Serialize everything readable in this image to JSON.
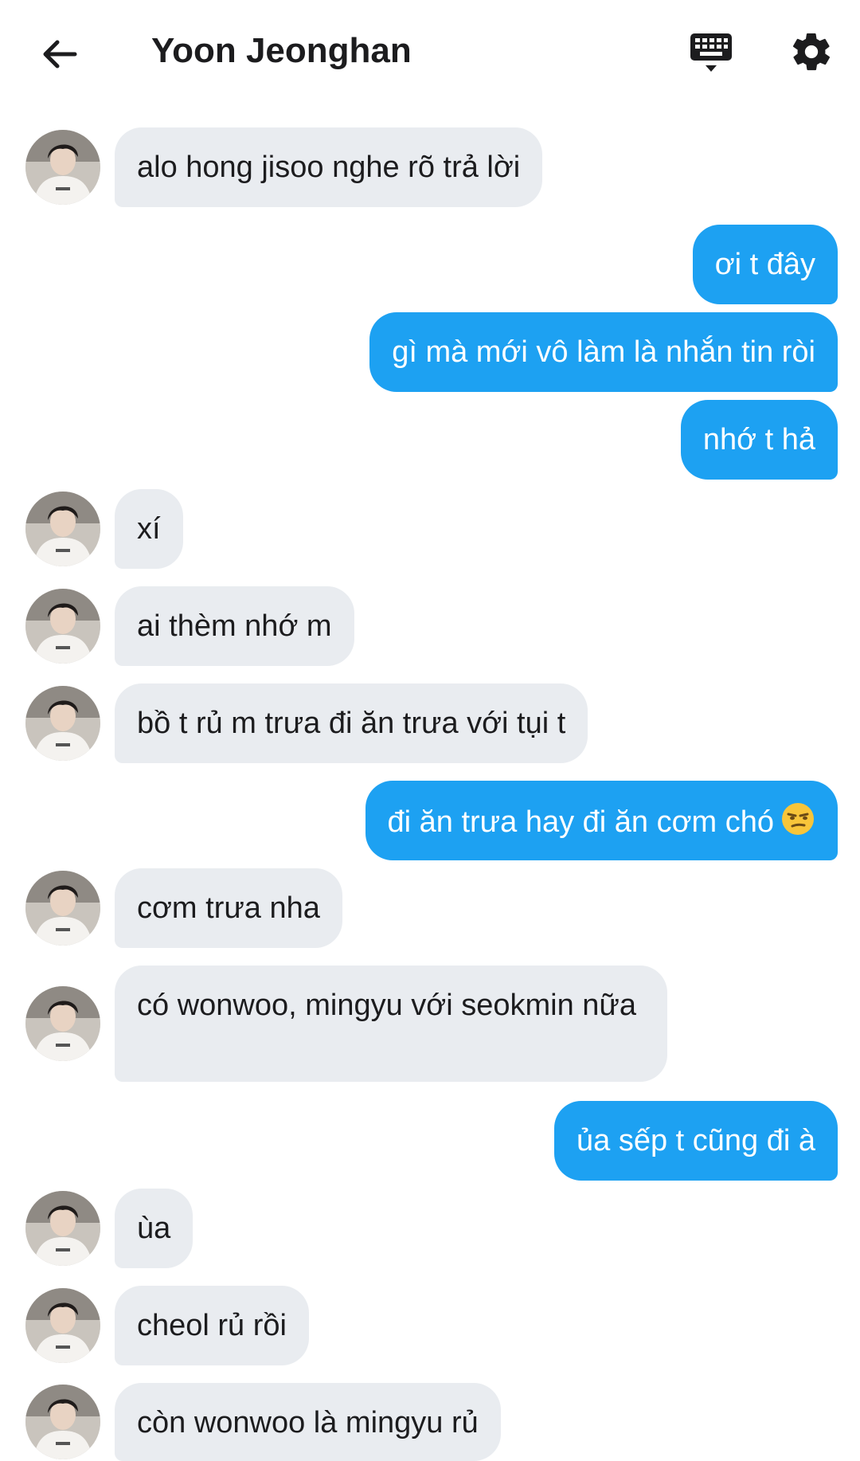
{
  "header": {
    "title": "Yoon Jeonghan"
  },
  "icons": {
    "back": "arrow-left-icon",
    "keyboard": "keyboard-icon",
    "settings": "gear-icon"
  },
  "colors": {
    "outgoing": "#1da1f2",
    "incoming": "#e9ecf0"
  },
  "messages": [
    {
      "side": "in",
      "text": "alo hong jisoo nghe rõ trả lời"
    },
    {
      "side": "out",
      "text": "ơi t đây"
    },
    {
      "side": "out",
      "text": "gì mà mới vô làm là nhắn tin ròi"
    },
    {
      "side": "out",
      "text": "nhớ t hả"
    },
    {
      "side": "in",
      "text": "xí"
    },
    {
      "side": "in",
      "text": "ai thèm nhớ m"
    },
    {
      "side": "in",
      "text": "bồ t rủ m trưa đi ăn trưa với tụi t"
    },
    {
      "side": "out",
      "text": "đi ăn trưa hay đi ăn cơm chó",
      "emoji": "unamused-face"
    },
    {
      "side": "in",
      "text": "cơm trưa nha"
    },
    {
      "side": "in",
      "text": "có wonwoo, mingyu với seokmin nữa"
    },
    {
      "side": "out",
      "text": "ủa sếp t cũng đi à"
    },
    {
      "side": "in",
      "text": "ùa"
    },
    {
      "side": "in",
      "text": "cheol rủ rồi"
    },
    {
      "side": "in",
      "text": "còn wonwoo là mingyu rủ"
    }
  ]
}
